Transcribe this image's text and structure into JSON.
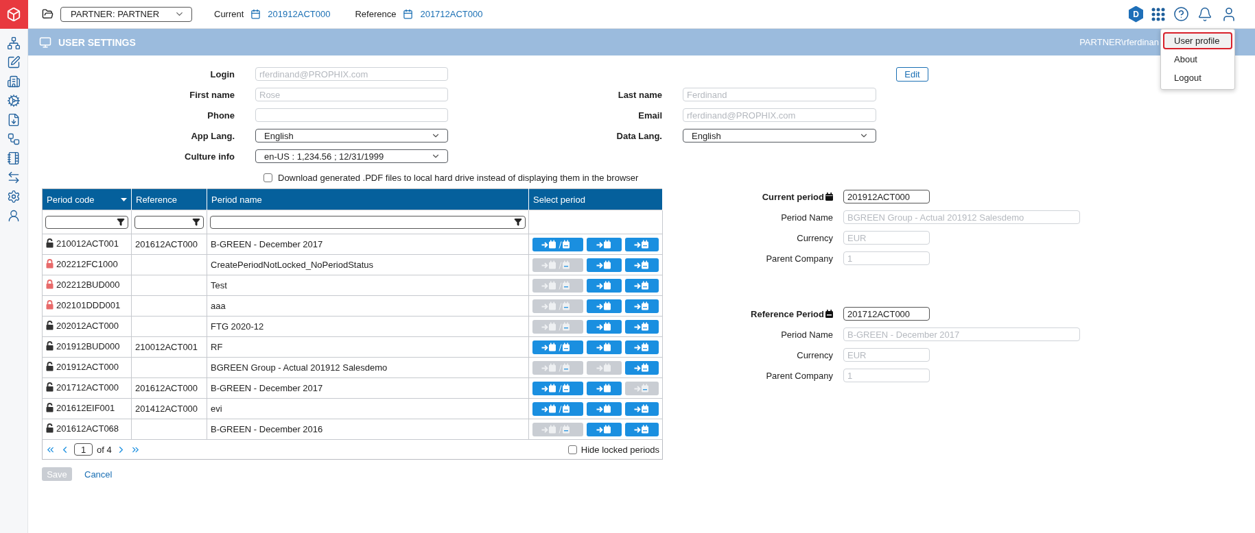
{
  "topbar": {
    "workspace": "PARTNER: PARTNER",
    "current_label": "Current",
    "current_value": "201912ACT000",
    "reference_label": "Reference",
    "reference_value": "201712ACT000",
    "badge": "D"
  },
  "user_menu": {
    "items": [
      {
        "label": "User profile",
        "selected": true
      },
      {
        "label": "About",
        "selected": false
      },
      {
        "label": "Logout",
        "selected": false
      }
    ]
  },
  "page_header": {
    "title": "USER SETTINGS",
    "user": "PARTNER\\rferdinan"
  },
  "form": {
    "edit_button": "Edit",
    "rows": [
      {
        "left": {
          "label": "Login",
          "kind": "text",
          "value": "rferdinand@PROPHIX.com",
          "disabled": true
        }
      },
      {
        "left": {
          "label": "First name",
          "kind": "text",
          "value": "Rose",
          "disabled": true
        },
        "right": {
          "label": "Last name",
          "kind": "text",
          "value": "Ferdinand",
          "disabled": true
        }
      },
      {
        "left": {
          "label": "Phone",
          "kind": "text",
          "disabled": true
        },
        "right": {
          "label": "Email",
          "kind": "text",
          "value": "rferdinand@PROPHIX.com",
          "disabled": true
        }
      },
      {
        "left": {
          "label": "App Lang.",
          "kind": "select",
          "value": "English",
          "disabled": false
        },
        "right": {
          "label": "Data Lang.",
          "kind": "select",
          "value": "English",
          "disabled": false
        }
      },
      {
        "left": {
          "label": "Culture info",
          "kind": "select",
          "value": "en-US : 1,234.56 ; 12/31/1999",
          "disabled": false
        }
      }
    ],
    "pdf_option": {
      "label": "Download generated .PDF files to local hard drive instead of displaying them in the browser",
      "checked": false
    }
  },
  "table": {
    "columns": [
      {
        "label": "Period code",
        "sorted": true,
        "filter": true
      },
      {
        "label": "Reference",
        "sorted": false,
        "filter": true
      },
      {
        "label": "Period name",
        "sorted": false,
        "filter": true
      },
      {
        "label": "Select period",
        "sorted": false,
        "filter": false
      }
    ],
    "rows": [
      {
        "code": "210012ACT001",
        "locked": false,
        "reference": "201612ACT000",
        "name": "B-GREEN - December 2017",
        "actions": [
          {
            "kind": "both",
            "disabled": false
          },
          {
            "kind": "current",
            "disabled": false
          },
          {
            "kind": "reference",
            "disabled": false
          }
        ]
      },
      {
        "code": "202212FC1000",
        "locked": true,
        "name": "CreatePeriodNotLocked_NoPeriodStatus",
        "actions": [
          {
            "kind": "both",
            "disabled": true
          },
          {
            "kind": "current",
            "disabled": false
          },
          {
            "kind": "reference",
            "disabled": false
          }
        ]
      },
      {
        "code": "202212BUD000",
        "locked": true,
        "name": "Test",
        "actions": [
          {
            "kind": "both",
            "disabled": true
          },
          {
            "kind": "current",
            "disabled": false
          },
          {
            "kind": "reference",
            "disabled": false
          }
        ]
      },
      {
        "code": "202101DDD001",
        "locked": true,
        "name": "aaa",
        "actions": [
          {
            "kind": "both",
            "disabled": true
          },
          {
            "kind": "current",
            "disabled": false
          },
          {
            "kind": "reference",
            "disabled": false
          }
        ]
      },
      {
        "code": "202012ACT000",
        "locked": false,
        "name": "FTG 2020-12",
        "actions": [
          {
            "kind": "both",
            "disabled": true
          },
          {
            "kind": "current",
            "disabled": false
          },
          {
            "kind": "reference",
            "disabled": false
          }
        ]
      },
      {
        "code": "201912BUD000",
        "locked": false,
        "reference": "210012ACT001",
        "name": "RF",
        "actions": [
          {
            "kind": "both",
            "disabled": false
          },
          {
            "kind": "current",
            "disabled": false
          },
          {
            "kind": "reference",
            "disabled": false
          }
        ]
      },
      {
        "code": "201912ACT000",
        "locked": false,
        "name": "BGREEN Group - Actual 201912 Salesdemo",
        "actions": [
          {
            "kind": "both",
            "disabled": true
          },
          {
            "kind": "current",
            "disabled": true
          },
          {
            "kind": "reference",
            "disabled": false
          }
        ]
      },
      {
        "code": "201712ACT000",
        "locked": false,
        "reference": "201612ACT000",
        "name": "B-GREEN - December 2017",
        "actions": [
          {
            "kind": "both",
            "disabled": false
          },
          {
            "kind": "current",
            "disabled": false
          },
          {
            "kind": "reference",
            "disabled": true
          }
        ]
      },
      {
        "code": "201612EIF001",
        "locked": false,
        "reference": "201412ACT000",
        "name": "evi",
        "actions": [
          {
            "kind": "both",
            "disabled": false
          },
          {
            "kind": "current",
            "disabled": false
          },
          {
            "kind": "reference",
            "disabled": false
          }
        ]
      },
      {
        "code": "201612ACT068",
        "locked": false,
        "name": "B-GREEN - December 2016",
        "actions": [
          {
            "kind": "both",
            "disabled": true
          },
          {
            "kind": "current",
            "disabled": false
          },
          {
            "kind": "reference",
            "disabled": false
          }
        ]
      }
    ],
    "pagination": {
      "page": "1",
      "total": "of 4"
    },
    "hide_locked": {
      "label": "Hide locked periods",
      "checked": false
    }
  },
  "buttons": {
    "save": {
      "label": "Save",
      "disabled": true
    },
    "cancel": {
      "label": "Cancel"
    }
  },
  "periods": [
    {
      "kind": "current",
      "title": "Current period",
      "code": "201912ACT000",
      "fields": [
        {
          "label": "Period Name",
          "value": "BGREEN Group - Actual 201912 Salesdemo"
        },
        {
          "label": "Currency",
          "value": "EUR"
        },
        {
          "label": "Parent Company",
          "value": "1"
        }
      ]
    },
    {
      "kind": "reference",
      "title": "Reference Period",
      "code": "201712ACT000",
      "fields": [
        {
          "label": "Period Name",
          "value": "B-GREEN - December 2017"
        },
        {
          "label": "Currency",
          "value": "EUR"
        },
        {
          "label": "Parent Company",
          "value": "1"
        }
      ]
    }
  ]
}
